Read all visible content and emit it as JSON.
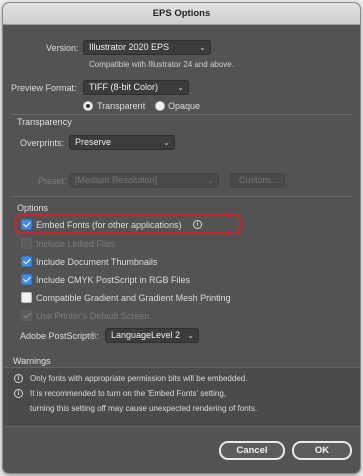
{
  "window": {
    "title": "EPS Options"
  },
  "version": {
    "label": "Version:",
    "value": "Illustrator 2020 EPS",
    "note": "Compatible with Illustrator 24 and above."
  },
  "preview": {
    "label": "Preview Format:",
    "value": "TIFF (8-bit Color)",
    "transparent_label": "Transparent",
    "opaque_label": "Opaque",
    "selected": "Transparent"
  },
  "transparency": {
    "title": "Transparency",
    "overprints_label": "Overprints:",
    "overprints_value": "Preserve",
    "preset_label": "Preset:",
    "preset_value": "[Medium Resolution]",
    "custom_label": "Custom..."
  },
  "options": {
    "title": "Options",
    "items": [
      {
        "label": "Embed Fonts (for other applications)",
        "checked": true,
        "enabled": true
      },
      {
        "label": "Include Linked Files",
        "checked": false,
        "enabled": false
      },
      {
        "label": "Include Document Thumbnails",
        "checked": true,
        "enabled": true
      },
      {
        "label": "Include CMYK PostScript in RGB Files",
        "checked": true,
        "enabled": true
      },
      {
        "label": "Compatible Gradient and Gradient Mesh Printing",
        "checked": false,
        "enabled": true
      },
      {
        "label": "Use Printer's Default Screen",
        "checked": true,
        "enabled": false
      }
    ],
    "postscript_label": "Adobe PostScript®:",
    "postscript_value": "LanguageLevel 2"
  },
  "warnings": {
    "title": "Warnings",
    "line1": "Only fonts with appropriate permission bits will be embedded.",
    "line2": "It is recommended to turn on the 'Embed Fonts' setting,",
    "line3": "turning this setting off may cause unexpected rendering of fonts."
  },
  "buttons": {
    "cancel": "Cancel",
    "ok": "OK"
  },
  "colors": {
    "highlight": "#d4202a",
    "accent": "#3e8bf0",
    "panel": "#535353"
  }
}
